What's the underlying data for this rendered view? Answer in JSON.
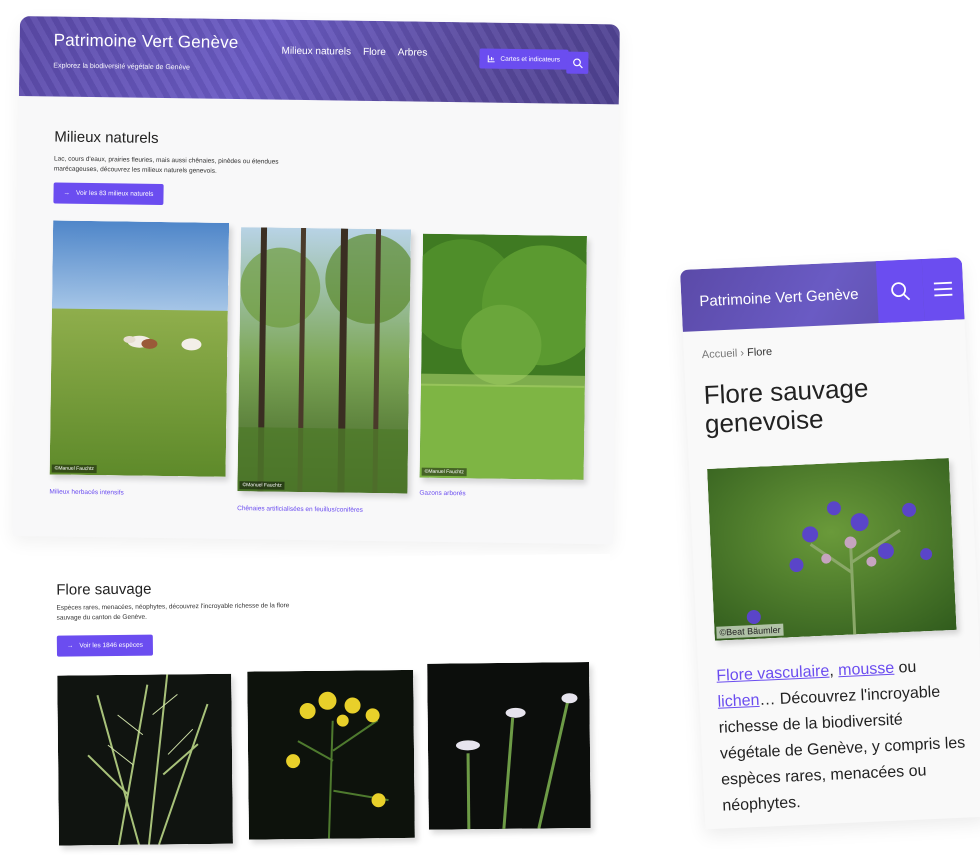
{
  "desktop": {
    "brand_title": "Patrimoine Vert Genève",
    "brand_sub": "Explorez la biodiversité végétale de Genève",
    "nav": [
      "Milieux naturels",
      "Flore",
      "Arbres"
    ],
    "maps_label": "Cartes et indicateurs",
    "milieux": {
      "title": "Milieux naturels",
      "text": "Lac, cours d'eaux, prairies fleuries, mais aussi chênaies, pinèdes ou étendues marécageuses, découvrez les milieux naturels genevois.",
      "cta": "Voir les 83 milieux naturels",
      "cards": [
        {
          "credit": "©Manuel Fauchtz",
          "caption": "Milieux herbacés intensifs"
        },
        {
          "credit": "©Manuel Fauchtz",
          "caption": "Chênaies artificialisées en feuillus/conifères"
        },
        {
          "credit": "©Manuel Fauchtz",
          "caption": "Gazons arborés"
        }
      ]
    },
    "flore": {
      "title": "Flore sauvage",
      "text": "Espèces rares, menacées, néophytes, découvrez l'incroyable richesse de la flore sauvage du canton de Genève.",
      "cta": "Voir les 1846 espèces"
    }
  },
  "mobile": {
    "brand_title": "Patrimoine Vert Genève",
    "crumb_home": "Accueil",
    "crumb_sep": "›",
    "crumb_current": "Flore",
    "h1": "Flore sauvage genevoise",
    "photo_credit": "©Beat Bäumler",
    "link1": "Flore vasculaire",
    "sep1": ", ",
    "link2": "mousse",
    "sep2": " ou ",
    "link3": "lichen",
    "text_rest": "… Découvrez l'incroyable richesse de la biodiversité végétale de Genève, y compris les espèces rares, menacées ou néophytes."
  },
  "colors": {
    "accent": "#6b4df0",
    "header": "#5b4aa8",
    "link": "#6b4df0"
  }
}
